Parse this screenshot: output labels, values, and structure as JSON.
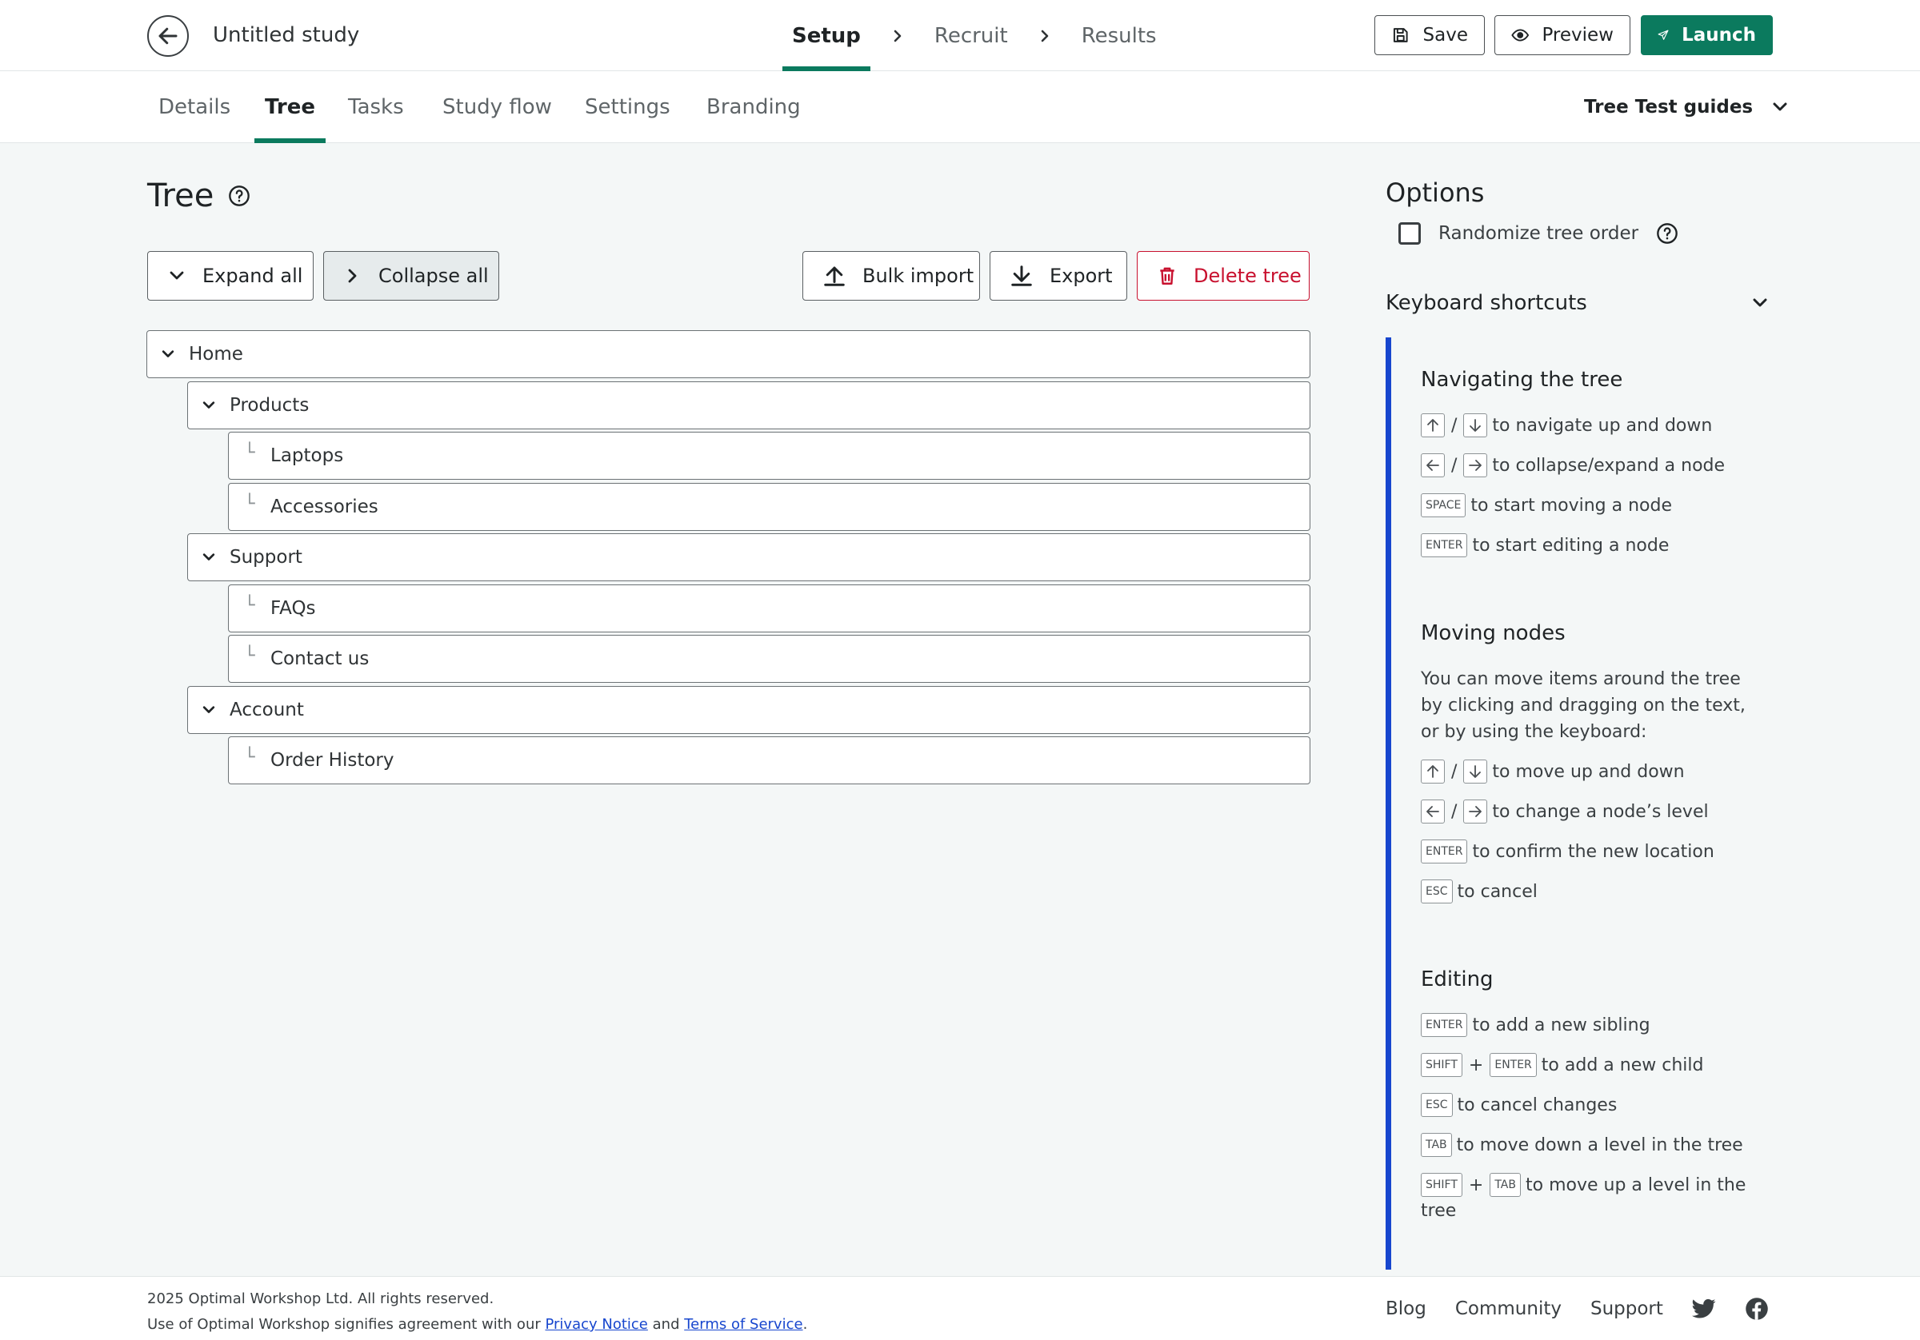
{
  "header": {
    "study_title": "Untitled study",
    "steps": [
      {
        "label": "Setup",
        "active": true
      },
      {
        "label": "Recruit",
        "active": false
      },
      {
        "label": "Results",
        "active": false
      }
    ],
    "save_label": "Save",
    "preview_label": "Preview",
    "launch_label": "Launch",
    "accent_color": "#0b7a5e"
  },
  "tabs": [
    {
      "label": "Details",
      "active": false
    },
    {
      "label": "Tree",
      "active": true
    },
    {
      "label": "Tasks",
      "active": false
    },
    {
      "label": "Study flow",
      "active": false
    },
    {
      "label": "Settings",
      "active": false
    },
    {
      "label": "Branding",
      "active": false
    }
  ],
  "guides_label": "Tree Test guides",
  "main": {
    "title": "Tree",
    "expand_all_label": "Expand all",
    "collapse_all_label": "Collapse all",
    "bulk_import_label": "Bulk import",
    "export_label": "Export",
    "delete_tree_label": "Delete tree",
    "danger_color": "#c8102e"
  },
  "tree": [
    {
      "label": "Home",
      "level": 0,
      "expandable": true
    },
    {
      "label": "Products",
      "level": 1,
      "expandable": true
    },
    {
      "label": "Laptops",
      "level": 2,
      "expandable": false
    },
    {
      "label": "Accessories",
      "level": 2,
      "expandable": false
    },
    {
      "label": "Support",
      "level": 1,
      "expandable": true
    },
    {
      "label": "FAQs",
      "level": 2,
      "expandable": false
    },
    {
      "label": "Contact us",
      "level": 2,
      "expandable": false
    },
    {
      "label": "Account",
      "level": 1,
      "expandable": true
    },
    {
      "label": "Order History",
      "level": 2,
      "expandable": false
    }
  ],
  "options": {
    "title": "Options",
    "randomize_label": "Randomize tree order",
    "randomize_checked": false,
    "shortcuts_title": "Keyboard shortcuts",
    "panel_accent": "#1746ce"
  },
  "shortcuts": {
    "nav_title": "Navigating the tree",
    "nav_updown": "to navigate up and down",
    "nav_leftright": "to collapse/expand a node",
    "nav_space": "to start moving a node",
    "nav_enter": "to start editing a node",
    "move_title": "Moving nodes",
    "move_para": "You can move items around the tree by clicking and dragging on the text, or by using the keyboard:",
    "move_updown": "to move up and down",
    "move_leftright": "to change a node’s level",
    "move_enter": "to confirm the new location",
    "move_esc": "to cancel",
    "edit_title": "Editing",
    "edit_enter": "to add a new sibling",
    "edit_shift_enter": "to add a new child",
    "edit_esc": "to cancel changes",
    "edit_tab": "to move down a level in the tree",
    "edit_shift_tab_1": "to move up a level in the",
    "edit_shift_tab_2": "tree",
    "keys": {
      "space": "SPACE",
      "enter": "ENTER",
      "esc": "ESC",
      "shift": "SHIFT",
      "tab": "TAB"
    },
    "slash": "/",
    "plus": "+"
  },
  "footer": {
    "copyright": "2025 Optimal Workshop Ltd. All rights reserved.",
    "agreement_prefix": "Use of Optimal Workshop signifies agreement with our",
    "privacy_label": "Privacy Notice",
    "and": "and",
    "terms_label": "Terms of Service",
    "period": ".",
    "links": [
      "Blog",
      "Community",
      "Support"
    ]
  }
}
